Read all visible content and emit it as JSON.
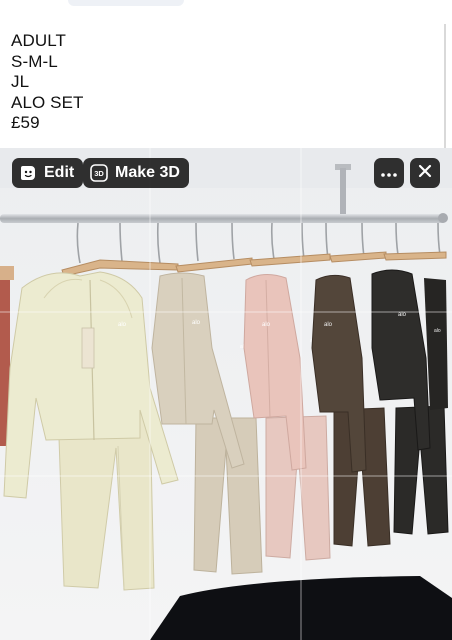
{
  "post": {
    "lines": [
      "ADULT",
      "S-M-L",
      "JL",
      "ALO SET",
      "£59"
    ]
  },
  "toolbar": {
    "edit_label": "Edit",
    "make3d_label": "Make 3D",
    "make3d_badge": "3D",
    "more_icon": "more-horizontal-icon",
    "close_icon": "close-icon",
    "edit_icon": "sparkle-face-icon"
  },
  "photo": {
    "brand_mark": "alo",
    "garment_colors": [
      "#e9e6c9",
      "#d8ccb8",
      "#e6c3bc",
      "#4d3f34",
      "#2b2a28"
    ]
  }
}
